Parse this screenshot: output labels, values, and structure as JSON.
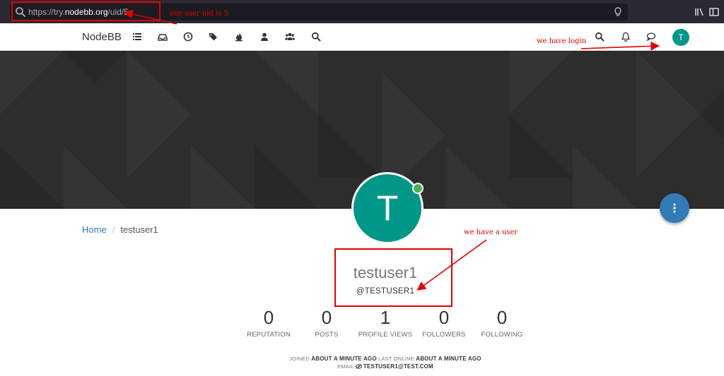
{
  "browser": {
    "url_prefix": "https://try.",
    "url_domain": "nodebb.org",
    "url_path": "/uid/5"
  },
  "navbar": {
    "brand": "NodeBB",
    "left_icons": [
      "list-icon",
      "inbox-icon",
      "clock-icon",
      "tags-icon",
      "fire-icon",
      "user-icon",
      "users-icon",
      "search-icon"
    ],
    "avatar_letter": "T"
  },
  "profile": {
    "avatar_letter": "T",
    "fullname": "testuser1",
    "username": "@TESTUSER1",
    "online": true,
    "accent": "#009688"
  },
  "breadcrumb": {
    "home": "Home",
    "sep": "/",
    "current": "testuser1"
  },
  "stats": [
    {
      "value": "0",
      "label": "REPUTATION"
    },
    {
      "value": "0",
      "label": "POSTS"
    },
    {
      "value": "1",
      "label": "PROFILE VIEWS"
    },
    {
      "value": "0",
      "label": "FOLLOWERS"
    },
    {
      "value": "0",
      "label": "FOLLOWING"
    }
  ],
  "meta": {
    "joined_label": "JOINED",
    "joined_value": "ABOUT A MINUTE AGO",
    "last_online_label": "LAST ONLINE",
    "last_online_value": "ABOUT A MINUTE AGO",
    "email_label": "EMAIL",
    "email_value": "TESTUSER1@TEST.COM"
  },
  "annotations": {
    "uid_note": "our user uid is 5",
    "login_note": "we have login",
    "user_note": "we have a user",
    "color": "#e00000"
  }
}
